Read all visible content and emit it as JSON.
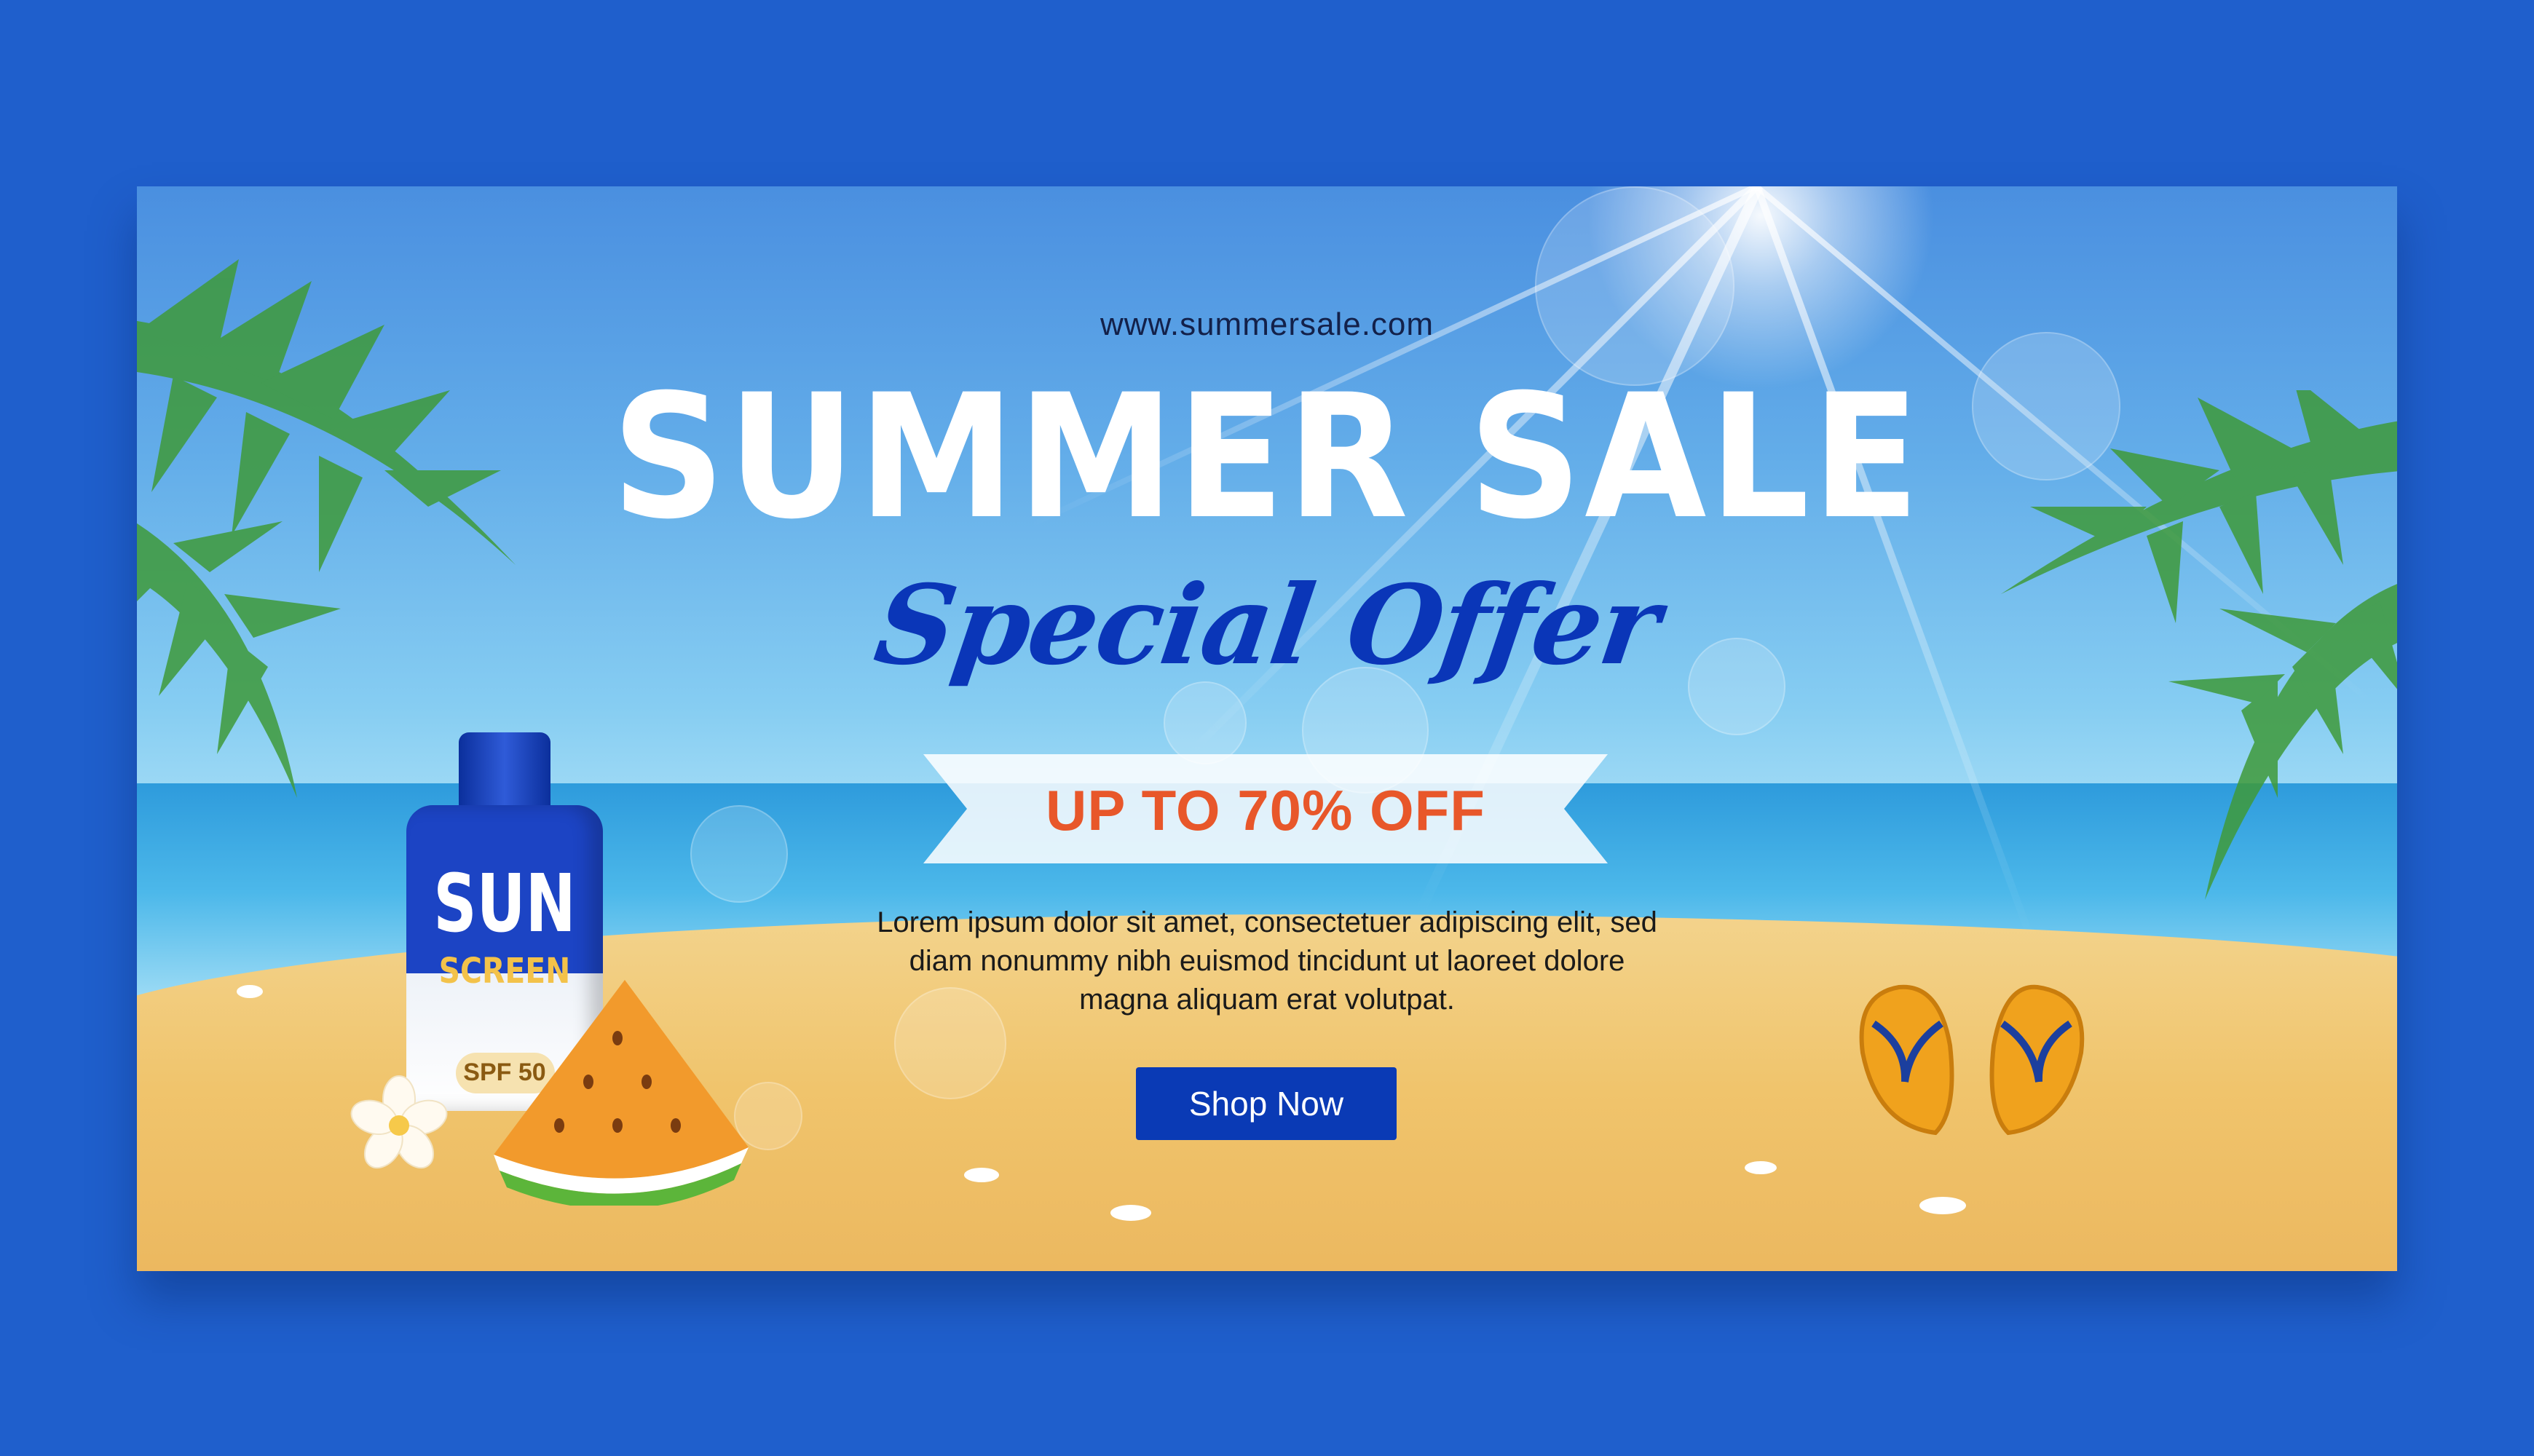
{
  "banner": {
    "url": "www.summersale.com",
    "title": "SUMMER SALE",
    "subtitle": "Special Offer",
    "discount": "UP TO 70% OFF",
    "description_lines": [
      "Lorem ipsum dolor sit amet, consectetuer adipiscing elit, sed",
      "diam nonummy nibh euismod tincidunt ut laoreet dolore",
      "magna aliquam erat volutpat."
    ],
    "cta_label": "Shop Now"
  },
  "sunscreen": {
    "brand_line1": "SUN",
    "brand_line2": "SCREEN",
    "spf": "SPF 50"
  },
  "colors": {
    "page_background": "#1f5fcc",
    "title": "#ffffff",
    "subtitle": "#0a36b8",
    "discount": "#e8572a",
    "button": "#0a3ab5"
  },
  "icons": [
    "sun-icon",
    "palm-leaf-icon",
    "sunscreen-bottle-icon",
    "watermelon-icon",
    "flower-icon",
    "flip-flops-icon",
    "seashell-icon"
  ]
}
